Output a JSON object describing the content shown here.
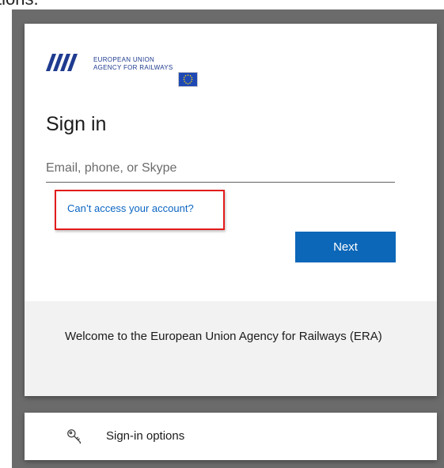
{
  "page_fragment": "tions.",
  "brand": {
    "name_line1": "EUROPEAN UNION",
    "name_line2": "AGENCY FOR RAILWAYS"
  },
  "signin": {
    "title": "Sign in",
    "email_placeholder": "Email, phone, or Skype",
    "email_value": "",
    "forgot_link": "Can’t access your account?",
    "next_label": "Next"
  },
  "welcome": {
    "message": "Welcome to the European Union Agency for Railways (ERA)"
  },
  "options": {
    "label": "Sign-in options",
    "icon": "key-icon"
  },
  "colors": {
    "accent": "#0c67b8",
    "link": "#0b65c2",
    "highlight": "#e31c1c",
    "brand_blue": "#1e3b8f"
  }
}
